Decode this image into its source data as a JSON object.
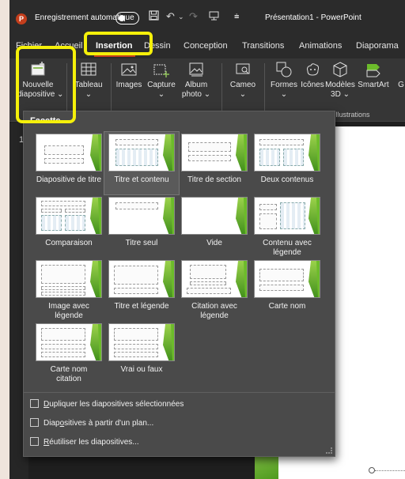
{
  "titlebar": {
    "logo_letter": "P",
    "autosave_label": "Enregistrement automatique",
    "document_title": "Présentation1  -  PowerPoint"
  },
  "tabs": [
    {
      "label": "Fichier",
      "active": false
    },
    {
      "label": "Accueil",
      "active": false
    },
    {
      "label": "Insertion",
      "active": true
    },
    {
      "label": "Dessin",
      "active": false
    },
    {
      "label": "Conception",
      "active": false
    },
    {
      "label": "Transitions",
      "active": false
    },
    {
      "label": "Animations",
      "active": false
    },
    {
      "label": "Diaporama",
      "active": false
    }
  ],
  "ribbon": {
    "buttons": [
      {
        "label_1": "Nouvelle",
        "label_2": "diapositive ⌄",
        "icon": "new-slide-icon"
      },
      {
        "label_1": "Tableau",
        "label_2": "⌄",
        "icon": "table-icon"
      },
      {
        "label_1": "Images",
        "label_2": "",
        "icon": "images-icon"
      },
      {
        "label_1": "Capture",
        "label_2": "⌄",
        "icon": "screenshot-icon"
      },
      {
        "label_1": "Album",
        "label_2": "photo ⌄",
        "icon": "photo-album-icon"
      },
      {
        "label_1": "Cameo",
        "label_2": "⌄",
        "icon": "cameo-icon"
      },
      {
        "label_1": "Formes",
        "label_2": "⌄",
        "icon": "shapes-icon"
      },
      {
        "label_1": "Icônes",
        "label_2": "",
        "icon": "icons-icon"
      },
      {
        "label_1": "Modèles",
        "label_2": "3D ⌄",
        "icon": "3d-models-icon"
      },
      {
        "label_1": "SmartArt",
        "label_2": "",
        "icon": "smartart-icon"
      },
      {
        "label_1": "G",
        "label_2": "",
        "icon": "chart-icon"
      }
    ],
    "group_illustrations": "Illustrations"
  },
  "slide_panel": {
    "slide_number": "1"
  },
  "dropdown": {
    "header": "Facette",
    "layouts": [
      {
        "label_1": "Diapositive de titre",
        "label_2": ""
      },
      {
        "label_1": "Titre et contenu",
        "label_2": ""
      },
      {
        "label_1": "Titre de section",
        "label_2": ""
      },
      {
        "label_1": "Deux contenus",
        "label_2": ""
      },
      {
        "label_1": "Comparaison",
        "label_2": ""
      },
      {
        "label_1": "Titre seul",
        "label_2": ""
      },
      {
        "label_1": "Vide",
        "label_2": ""
      },
      {
        "label_1": "Contenu avec",
        "label_2": "légende"
      },
      {
        "label_1": "Image avec",
        "label_2": "légende"
      },
      {
        "label_1": "Titre et légende",
        "label_2": ""
      },
      {
        "label_1": "Citation avec",
        "label_2": "légende"
      },
      {
        "label_1": "Carte nom",
        "label_2": ""
      },
      {
        "label_1": "Carte nom",
        "label_2": "citation"
      },
      {
        "label_1": "Vrai ou faux",
        "label_2": ""
      }
    ],
    "selected_layout": "Titre et contenu",
    "commands": [
      {
        "accel": "D",
        "rest": "upliquer les diapositives sélectionnées",
        "icon": "duplicate-slides-icon"
      },
      {
        "prefix": "Diap",
        "accel": "o",
        "rest": "sitives à partir d'un plan...",
        "icon": "outline-slides-icon"
      },
      {
        "accel": "R",
        "rest": "éutiliser les diapositives...",
        "icon": "reuse-slides-icon"
      }
    ]
  },
  "colors": {
    "accent": "#c43e1c",
    "highlight": "#f5f00a",
    "theme_green": "#6cbb2a"
  }
}
